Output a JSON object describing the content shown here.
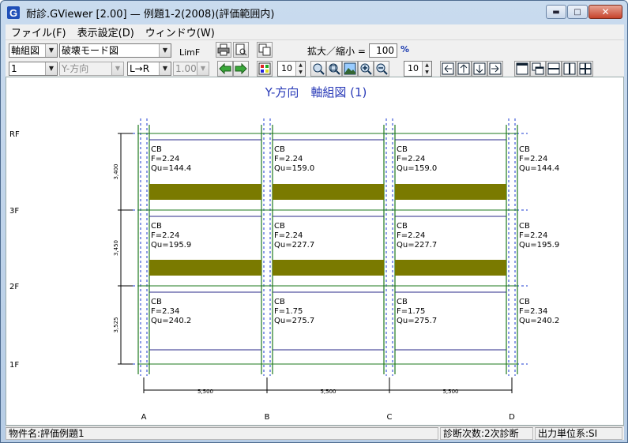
{
  "window": {
    "title": "耐診.GViewer [2.00]  — 例題1-2(2008)(評価範囲内)",
    "app_icon": "G"
  },
  "menu": [
    {
      "label": "ファイル(F)"
    },
    {
      "label": "表示設定(D)"
    },
    {
      "label": "ウィンドウ(W)"
    }
  ],
  "toolbar": {
    "view_select": "軸組図",
    "mode_select": "破壊モード図",
    "limf_label": "LimF",
    "frame_select": "1",
    "direction_select": "Y-方向",
    "order_select": "L→R",
    "factor_select": "1.00",
    "zoom_label": "拡大／縮小 =",
    "zoom_value": "100",
    "zoom_unit": "%",
    "spin1": "10",
    "spin2": "10"
  },
  "diagram": {
    "title": "Y-方向　軸組図 (1)",
    "floors": [
      "RF",
      "3F",
      "2F",
      "1F"
    ],
    "story_heights": [
      "3,400",
      "3,450",
      "3,525"
    ],
    "axes": [
      "A",
      "B",
      "C",
      "D"
    ],
    "spans": [
      "5,500",
      "5,500",
      "5,500"
    ],
    "stories": [
      {
        "name": "3F",
        "cells": [
          {
            "grade": "CB",
            "F": "F=2.24",
            "Qu": "Qu=144.4"
          },
          {
            "grade": "CB",
            "F": "F=2.24",
            "Qu": "Qu=159.0"
          },
          {
            "grade": "CB",
            "F": "F=2.24",
            "Qu": "Qu=159.0"
          },
          {
            "grade": "CB",
            "F": "F=2.24",
            "Qu": "Qu=144.4"
          }
        ]
      },
      {
        "name": "2F",
        "cells": [
          {
            "grade": "CB",
            "F": "F=2.24",
            "Qu": "Qu=195.9"
          },
          {
            "grade": "CB",
            "F": "F=2.24",
            "Qu": "Qu=227.7"
          },
          {
            "grade": "CB",
            "F": "F=2.24",
            "Qu": "Qu=227.7"
          },
          {
            "grade": "CB",
            "F": "F=2.24",
            "Qu": "Qu=195.9"
          }
        ]
      },
      {
        "name": "1F",
        "cells": [
          {
            "grade": "CB",
            "F": "F=2.34",
            "Qu": "Qu=240.2"
          },
          {
            "grade": "CB",
            "F": "F=1.75",
            "Qu": "Qu=275.7"
          },
          {
            "grade": "CB",
            "F": "F=1.75",
            "Qu": "Qu=275.7"
          },
          {
            "grade": "CB",
            "F": "F=2.34",
            "Qu": "Qu=240.2"
          }
        ]
      }
    ],
    "colors": {
      "title": "#2a3bb8",
      "column": "#1e7a1e",
      "beam": "#2a2a8a",
      "grid": "#1a3ad0",
      "hinge_band": "#7a7a00",
      "dimension": "#000000"
    }
  },
  "status": {
    "property": "物件名:評価例題1",
    "diagnosis": "診断次数:2次診断",
    "units": "出力単位系:SI"
  }
}
